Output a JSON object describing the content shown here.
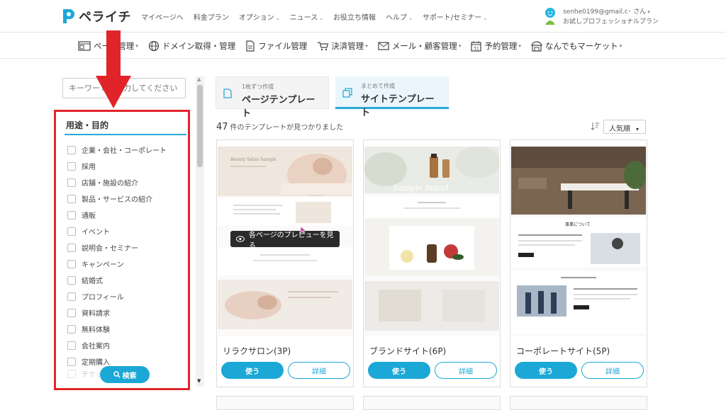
{
  "brand": {
    "name": "ペライチ",
    "accent": "#1ba8d6",
    "highlight": "#e0242a"
  },
  "topnav": {
    "items": [
      {
        "label": "マイページへ",
        "caret": false
      },
      {
        "label": "料金プラン",
        "caret": false
      },
      {
        "label": "オプション",
        "caret": true
      },
      {
        "label": "ニュース",
        "caret": true
      },
      {
        "label": "お役立ち情報",
        "caret": false
      },
      {
        "label": "ヘルプ",
        "caret": true
      },
      {
        "label": "サポート/セミナー",
        "caret": true
      }
    ]
  },
  "account": {
    "email": "senhe0199@gmail.c",
    "suffix": "さん",
    "plan": "お試しプロフェッショナルプラン"
  },
  "subnav": {
    "items": [
      {
        "label": "ページ管理",
        "icon": "page-icon"
      },
      {
        "label": "ドメイン取得・管理",
        "icon": "globe-icon"
      },
      {
        "label": "ファイル管理",
        "icon": "file-icon"
      },
      {
        "label": "決済管理",
        "icon": "cart-icon"
      },
      {
        "label": "メール・顧客管理",
        "icon": "mail-icon"
      },
      {
        "label": "予約管理",
        "icon": "calendar-icon"
      },
      {
        "label": "なんでもマーケット",
        "icon": "shop-icon"
      }
    ]
  },
  "sidebar": {
    "search_placeholder": "キーワードを入力してください",
    "filter_title": "用途・目的",
    "filters": [
      "企業・会社・コーポレート",
      "採用",
      "店舗・施設の紹介",
      "製品・サービスの紹介",
      "通販",
      "イベント",
      "説明会・セミナー",
      "キャンペーン",
      "結婚式",
      "プロフィール",
      "資料請求",
      "無料体験",
      "会社案内",
      "定期購入"
    ],
    "faded_item": "チケット",
    "search_button": "検索"
  },
  "tabs": [
    {
      "small": "1枚ずつ作成",
      "big": "ページテンプレート",
      "icon": "document-icon"
    },
    {
      "small": "まとめて作成",
      "big": "サイトテンプレート",
      "icon": "documents-icon"
    }
  ],
  "results": {
    "count": "47",
    "text": "件のテンプレートが見つかりました",
    "sort": "人気順"
  },
  "preview_tooltip": "各ページのプレビューを見る",
  "cards": [
    {
      "title": "リラクサロン(3P)",
      "use": "使う",
      "detail": "詳細",
      "img_text_1": "Beauty Salon Sample"
    },
    {
      "title": "ブランドサイト(6P)",
      "use": "使う",
      "detail": "詳細",
      "img_text_1": "Sample Brand"
    },
    {
      "title": "コーポレートサイト(5P)",
      "use": "使う",
      "detail": "詳細",
      "img_text_1": "事業について"
    }
  ]
}
